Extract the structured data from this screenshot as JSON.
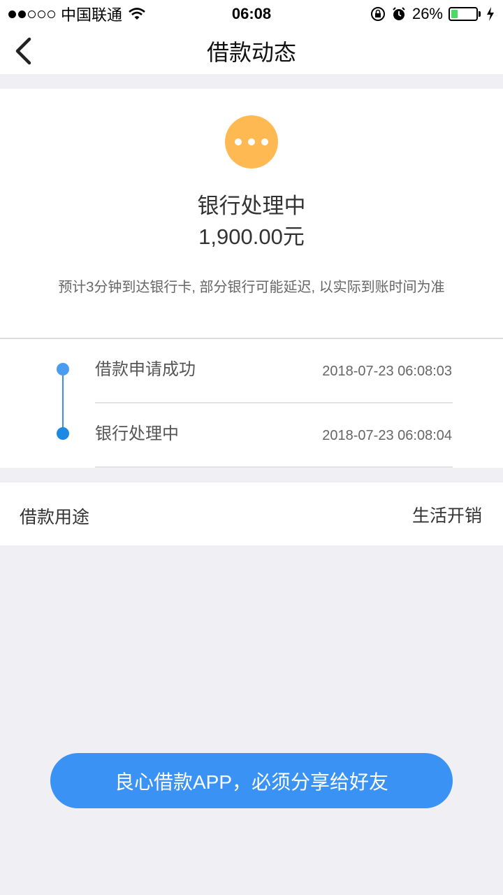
{
  "status_bar": {
    "carrier": "中国联通",
    "time": "06:08",
    "battery_percent": "26%",
    "battery_level": 0.26,
    "signal_bars_filled": 2,
    "signal_bars_total": 5,
    "icons": [
      "wifi-icon",
      "rotation-lock-icon",
      "alarm-icon",
      "battery-icon",
      "charging-bolt-icon"
    ]
  },
  "nav": {
    "title": "借款动态",
    "back_icon": "chevron-left-icon"
  },
  "status": {
    "icon": "more-dots-icon",
    "icon_color": "#ffb952",
    "title": "银行处理中",
    "amount": "1,900.00元",
    "note": "预计3分钟到达银行卡, 部分银行可能延迟, 以实际到账时间为准"
  },
  "timeline": {
    "accent_color": "#3b8fe6",
    "items": [
      {
        "label": "借款申请成功",
        "time": "2018-07-23 06:08:03"
      },
      {
        "label": "银行处理中",
        "time": "2018-07-23 06:08:04"
      }
    ]
  },
  "purpose": {
    "label": "借款用途",
    "value": "生活开销"
  },
  "share_button": {
    "label": "良心借款APP，必须分享给好友",
    "color": "#3a92f5"
  }
}
